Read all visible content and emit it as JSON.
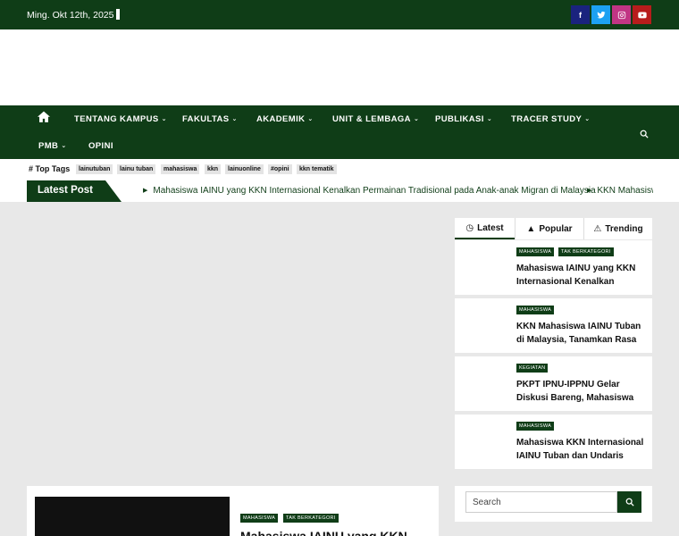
{
  "topbar": {
    "date": "Ming. Okt 12th, 2025",
    "social": [
      {
        "icon": "facebook-icon",
        "glyph": "f",
        "color": "#1a237e"
      },
      {
        "icon": "twitter-icon",
        "glyph": "",
        "color": "#1da1f2"
      },
      {
        "icon": "instagram-icon",
        "glyph": "",
        "color": "#c13584"
      },
      {
        "icon": "youtube-icon",
        "glyph": "",
        "color": "#b71c1c"
      }
    ]
  },
  "nav": {
    "items": [
      {
        "label": "TENTANG KAMPUS",
        "dropdown": true
      },
      {
        "label": "FAKULTAS",
        "dropdown": true
      },
      {
        "label": "AKADEMIK",
        "dropdown": true
      },
      {
        "label": "UNIT & LEMBAGA",
        "dropdown": true
      },
      {
        "label": "PUBLIKASI",
        "dropdown": true
      },
      {
        "label": "TRACER STUDY",
        "dropdown": true
      },
      {
        "label": "PMB",
        "dropdown": true
      },
      {
        "label": "OPINI",
        "dropdown": false
      }
    ]
  },
  "tags": {
    "label": "Top Tags",
    "items": [
      "lainutuban",
      "lainu tuban",
      "mahasiswa",
      "kkn",
      "lainuonline",
      "#opini",
      "kkn tematik"
    ]
  },
  "latest": {
    "label": "Latest Post",
    "ticker": [
      "Mahasiswa IAINU yang KKN Internasional Kenalkan Permainan Tradisional pada Anak-anak Migran di Malaysia",
      "KKN Mahasiswa IAINU Tuban di Malaysia, Tanamkan Rasa"
    ]
  },
  "sidebar": {
    "tabs": [
      {
        "label": "Latest",
        "icon": "clock-icon"
      },
      {
        "label": "Popular",
        "icon": "thumbs-up-icon"
      },
      {
        "label": "Trending",
        "icon": "fire-icon"
      }
    ],
    "posts": [
      {
        "categories": [
          "MAHASISWA",
          "TAK BERKATEGORI"
        ],
        "title": "Mahasiswa IAINU yang KKN Internasional Kenalkan"
      },
      {
        "categories": [
          "MAHASISWA"
        ],
        "title": "KKN Mahasiswa IAINU Tuban di Malaysia, Tanamkan Rasa"
      },
      {
        "categories": [
          "KEGIATAN"
        ],
        "title": "PKPT IPNU-IPPNU Gelar Diskusi Bareng, Mahasiswa"
      },
      {
        "categories": [
          "MAHASISWA"
        ],
        "title": "Mahasiswa KKN Internasional IAINU Tuban dan Undaris"
      }
    ],
    "search_placeholder": "Search"
  },
  "feature": {
    "categories": [
      "MAHASISWA",
      "TAK BERKATEGORI"
    ],
    "title": "Mahasiswa IAINU yang KKN"
  },
  "colors": {
    "brand": "#0f3d17",
    "background": "#e8e8e8"
  }
}
